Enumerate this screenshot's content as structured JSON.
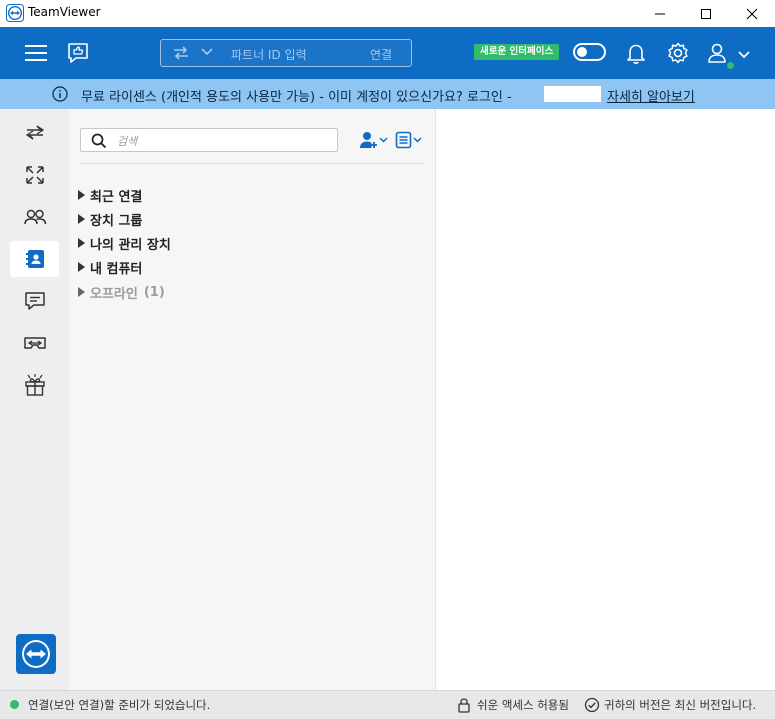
{
  "window": {
    "title": "TeamViewer"
  },
  "header": {
    "partner_id_placeholder": "파트너 ID 입력",
    "connect_label": "연결",
    "new_ui_badge": "새로운 인터페이스",
    "new_ui_toggle_on": false
  },
  "banner": {
    "text": "무료 라이센스 (개인적 용도의 사용만 가능) - 이미 계정이 있으신가요? 로그인 -",
    "link": "자세히 알아보기"
  },
  "leftnav": {
    "items": [
      {
        "icon": "remote-control-icon"
      },
      {
        "icon": "meeting-expand-icon"
      },
      {
        "icon": "contacts-people-icon"
      },
      {
        "icon": "computers-contacts-icon",
        "active": true
      },
      {
        "icon": "chat-icon"
      },
      {
        "icon": "augmented-reality-icon"
      },
      {
        "icon": "gift-icon"
      }
    ]
  },
  "contacts": {
    "search_placeholder": "검색",
    "groups": [
      {
        "label": "최근 연결"
      },
      {
        "label": "장치 그룹"
      },
      {
        "label": "나의 관리 장치"
      },
      {
        "label": "내 컴퓨터"
      },
      {
        "label": "오프라인",
        "count": "(1)"
      }
    ]
  },
  "statusbar": {
    "status": "연결(보안 연결)할 준비가 되었습니다.",
    "easy_access": "쉬운 액세스 허용됨",
    "version": "귀하의 버전은 최신 버전입니다."
  },
  "colors": {
    "brand_blue": "#0e6cc4",
    "banner_blue": "#8fc5f3",
    "status_green": "#2ebd6b"
  }
}
